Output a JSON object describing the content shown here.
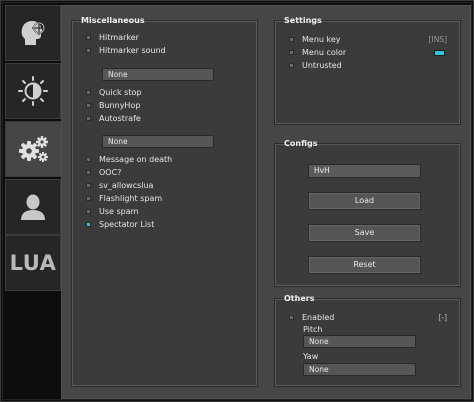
{
  "sidebar": {
    "tabs": [
      {
        "name": "aimbot",
        "icon": "head-crosshair-icon"
      },
      {
        "name": "visuals",
        "icon": "brightness-icon"
      },
      {
        "name": "misc",
        "icon": "gears-icon",
        "active": true
      },
      {
        "name": "players",
        "icon": "user-icon"
      },
      {
        "name": "lua",
        "label": "LUA"
      }
    ]
  },
  "misc": {
    "title": "Miscellaneous",
    "items": [
      {
        "label": "Hitmarker",
        "checked": false
      },
      {
        "label": "Hitmarker sound",
        "checked": false
      }
    ],
    "dropdown1": "None",
    "items2": [
      {
        "label": "Quick stop",
        "checked": false
      },
      {
        "label": "BunnyHop",
        "checked": false
      },
      {
        "label": "Autostrafe",
        "checked": false
      }
    ],
    "dropdown2": "None",
    "items3": [
      {
        "label": "Message on death",
        "checked": false
      },
      {
        "label": "OOC?",
        "checked": false
      },
      {
        "label": "sv_allowcslua",
        "checked": false
      },
      {
        "label": "Flashlight spam",
        "checked": false
      },
      {
        "label": "Use spam",
        "checked": false
      },
      {
        "label": "Spectator List",
        "checked": true
      }
    ]
  },
  "settings": {
    "title": "Settings",
    "menu_key_label": "Menu key",
    "menu_key_value": "[INS]",
    "menu_color_label": "Menu color",
    "menu_color": "#35c3d8",
    "untrusted_label": "Untrusted"
  },
  "configs": {
    "title": "Configs",
    "name_value": "HvH",
    "load_label": "Load",
    "save_label": "Save",
    "reset_label": "Reset"
  },
  "others": {
    "title": "Others",
    "enabled_label": "Enabled",
    "enabled_key": "[-]",
    "pitch_label": "Pitch",
    "pitch_value": "None",
    "yaw_label": "Yaw",
    "yaw_value": "None"
  },
  "colors": {
    "accent": "#35c3d8",
    "panel": "#464646",
    "sidebar": "#262626"
  }
}
